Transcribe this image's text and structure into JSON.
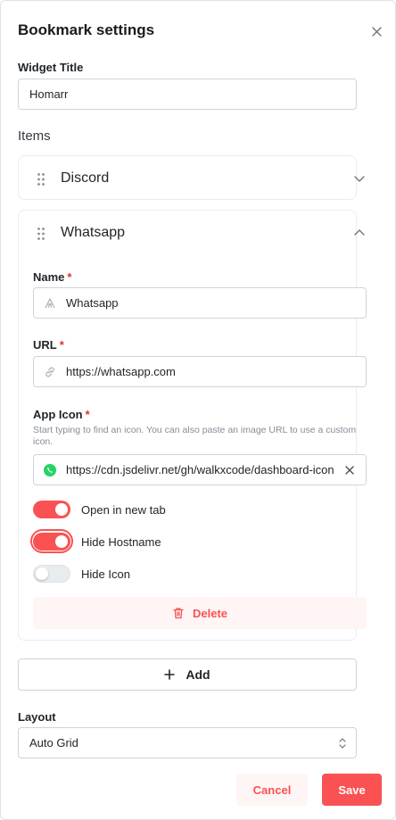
{
  "modal": {
    "title": "Bookmark settings",
    "close_icon": "close-icon"
  },
  "widget_title": {
    "label": "Widget Title",
    "value": "Homarr"
  },
  "items_section": {
    "label": "Items",
    "items": [
      {
        "name": "Discord",
        "expanded": false,
        "chevron_icon": "chevron-down-icon"
      },
      {
        "name": "Whatsapp",
        "expanded": true,
        "chevron_icon": "chevron-up-icon",
        "fields": {
          "name_label": "Name",
          "name_value": "Whatsapp",
          "url_label": "URL",
          "url_value": "https://whatsapp.com",
          "app_icon_label": "App Icon",
          "app_icon_hint": "Start typing to find an icon. You can also paste an image URL to use a custom icon.",
          "app_icon_value": "https://cdn.jsdelivr.net/gh/walkxcode/dashboard-icons/png/whatsapp.png",
          "required_marker": "*"
        },
        "toggles": [
          {
            "label": "Open in new tab",
            "on": true
          },
          {
            "label": "Hide Hostname",
            "on": true,
            "focused": true
          },
          {
            "label": "Hide Icon",
            "on": false
          }
        ],
        "delete_label": "Delete"
      }
    ]
  },
  "add_button": {
    "label": "Add",
    "icon": "plus-icon"
  },
  "layout": {
    "label": "Layout",
    "selected": "Auto Grid",
    "icon": "selector-arrows-icon"
  },
  "footer": {
    "cancel_label": "Cancel",
    "save_label": "Save"
  },
  "colors": {
    "accent": "#fa5252",
    "accent_light": "#fff5f5",
    "whatsapp_green": "#25d366"
  }
}
